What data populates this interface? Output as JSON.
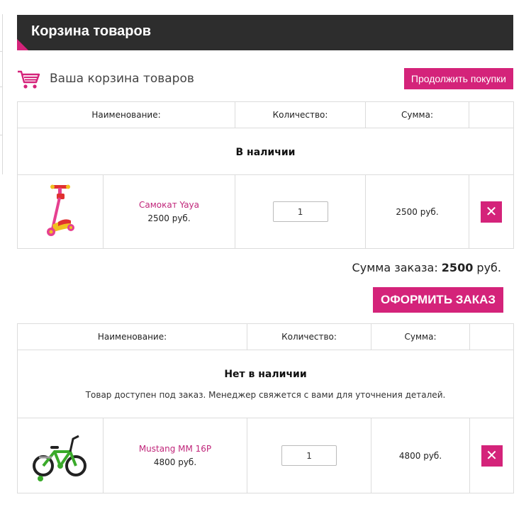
{
  "header": {
    "title": "Корзина товаров"
  },
  "cart_bar": {
    "icon": "shopping-cart-icon",
    "caption": "Ваша корзина товаров",
    "continue_label": "Продолжить покупки"
  },
  "table1": {
    "columns": [
      "Наименование:",
      "Количество:",
      "Сумма:",
      ""
    ],
    "section_title": "В наличии",
    "items": [
      {
        "name": "Самокат Yaya",
        "price": "2500 руб.",
        "qty": "1",
        "sum": "2500 руб.",
        "delete_icon": "close-icon"
      }
    ]
  },
  "order": {
    "total_label": "Сумма заказа:",
    "total_value": "2500",
    "total_currency": "руб.",
    "checkout_label": "ОФОРМИТЬ ЗАКАЗ"
  },
  "table2": {
    "columns": [
      "Наименование:",
      "Количество:",
      "Сумма:",
      ""
    ],
    "section_title": "Нет в наличии",
    "section_note": "Товар доступен под заказ. Менеджер свяжется с вами для уточнения деталей.",
    "items": [
      {
        "name": "Mustang MM 16P",
        "price": "4800 руб.",
        "qty": "1",
        "sum": "4800 руб.",
        "delete_icon": "close-icon"
      }
    ]
  },
  "colors": {
    "accent": "#d4237a",
    "header_bg": "#2d2d2d",
    "link": "#c0267a"
  }
}
